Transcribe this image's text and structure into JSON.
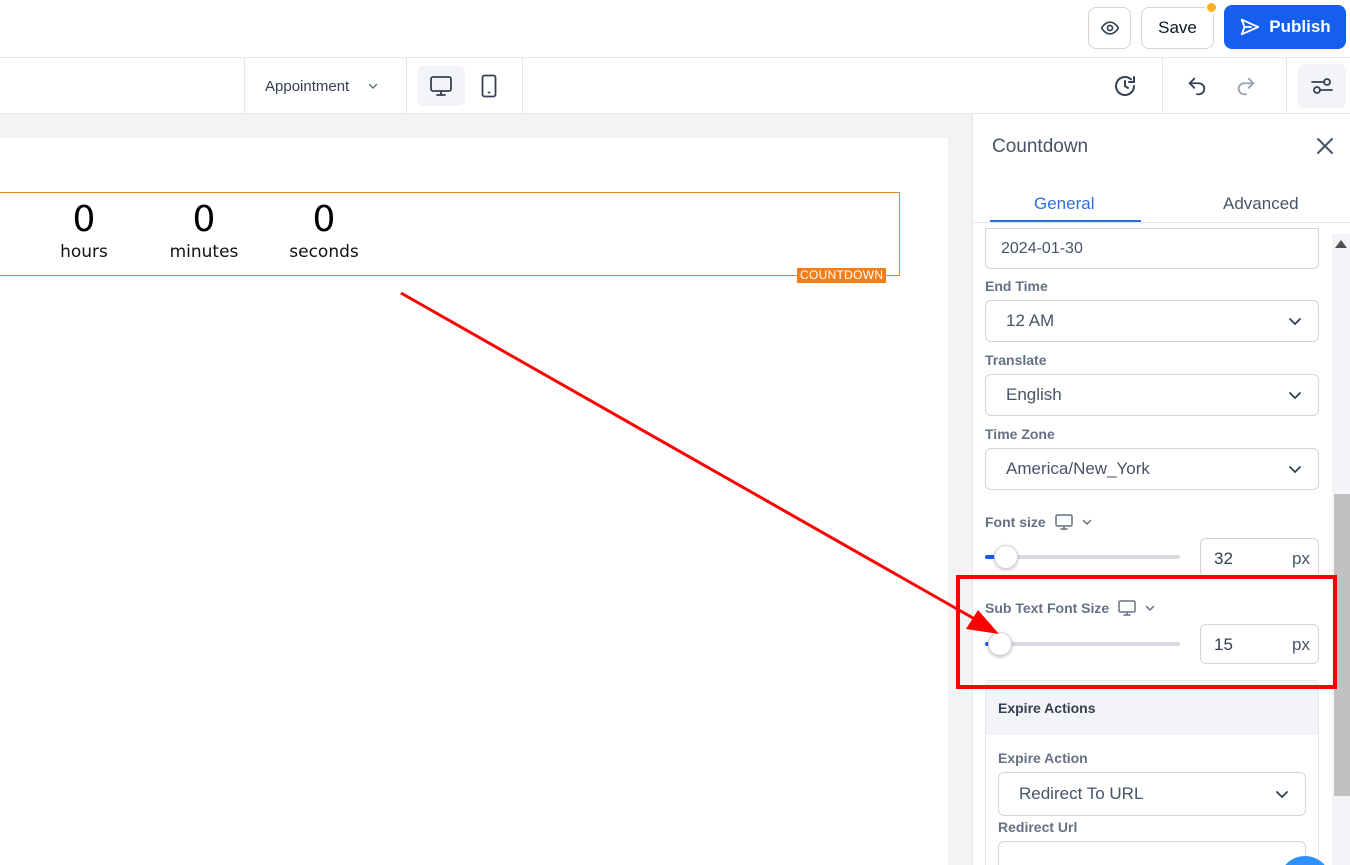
{
  "header": {
    "save_label": "Save",
    "publish_label": "Publish"
  },
  "toolbar": {
    "page_select_value": "Appointment"
  },
  "canvas": {
    "countdown": {
      "units": [
        {
          "value": "0",
          "label": "hours"
        },
        {
          "value": "0",
          "label": "minutes"
        },
        {
          "value": "0",
          "label": "seconds"
        }
      ],
      "tag": "COUNTDOWN"
    }
  },
  "panel": {
    "title": "Countdown",
    "tabs": {
      "general": "General",
      "advanced": "Advanced"
    },
    "end_date_value": "2024-01-30",
    "end_time": {
      "label": "End Time",
      "value": "12 AM"
    },
    "translate": {
      "label": "Translate",
      "value": "English"
    },
    "time_zone": {
      "label": "Time Zone",
      "value": "America/New_York"
    },
    "font_size": {
      "label": "Font size",
      "value": "32",
      "unit": "px"
    },
    "sub_text_font_size": {
      "label": "Sub Text Font Size",
      "value": "15",
      "unit": "px"
    },
    "expire": {
      "section_title": "Expire Actions",
      "action_label": "Expire Action",
      "action_value": "Redirect To URL",
      "redirect_label": "Redirect Url",
      "redirect_placeholder": "#"
    }
  },
  "colors": {
    "accent": "#155eef",
    "tab_active": "#2e6fd8",
    "countdown_border": "#e8862a",
    "annotation_red": "#ff0000"
  }
}
